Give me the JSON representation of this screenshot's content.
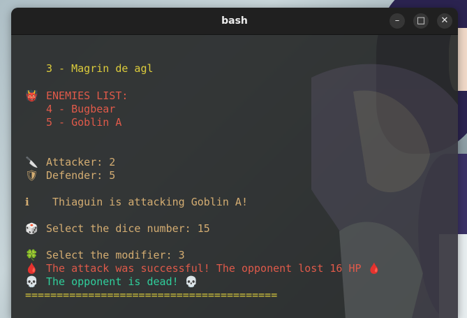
{
  "window": {
    "title": "bash",
    "minimize_symbol": "–",
    "maximize_symbol": "□",
    "close_symbol": "✕"
  },
  "terminal": {
    "ally_line": "3 - Magrin de agl",
    "enemies_header": "ENEMIES LIST:",
    "enemies": [
      "4 - Bugbear",
      "5 - Goblin A"
    ],
    "attacker": "Attacker: 2",
    "defender": "Defender: 5",
    "info": " Thiaguin is attacking Goblin A!",
    "dice_prompt": "Select the dice number: 15",
    "modifier_prompt": "Select the modifier: 3",
    "attack_result": "The attack was successful! The opponent lost 16 HP",
    "death_message": "The opponent is dead!",
    "separator": "========================================"
  },
  "icons": {
    "enemies": "ogre-icon",
    "attacker": "knife-icon",
    "defender": "shield-icon",
    "info": "info-icon",
    "dice": "dice-icon",
    "modifier": "clover-icon",
    "blood": "drop-of-blood-icon",
    "skull": "skull-icon"
  },
  "colors": {
    "yellow": "#dccc3c",
    "red": "#e05a4a",
    "tan": "#d4ad72",
    "green": "#2fcf9c",
    "titlebar": "#202020"
  }
}
